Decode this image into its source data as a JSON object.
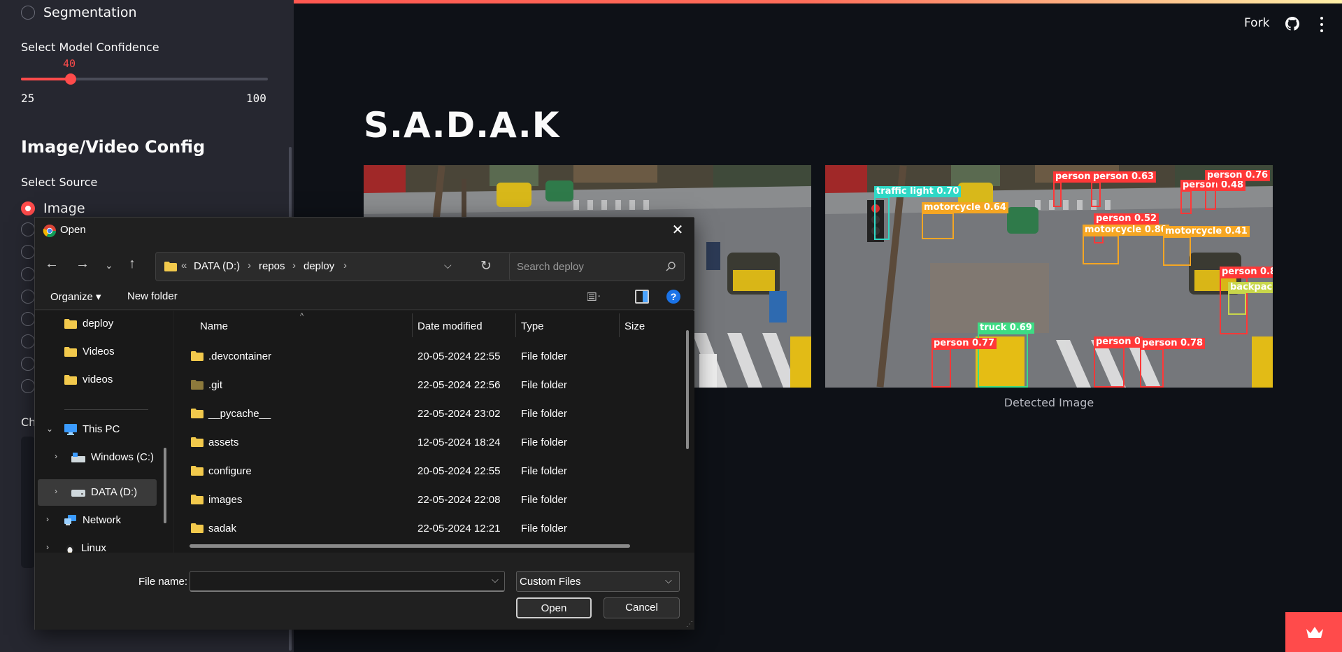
{
  "sidebar": {
    "model_task_option": "Segmentation",
    "confidence": {
      "label": "Select Model Confidence",
      "value": "40",
      "min": "25",
      "max": "100",
      "fraction": 0.2
    },
    "section_heading": "Image/Video Config",
    "source_label": "Select Source",
    "source_selected": "Image",
    "partial_label": "Ch"
  },
  "header": {
    "fork_label": "Fork",
    "github_icon": "github-icon",
    "menu_icon": "kebab-menu-icon"
  },
  "main": {
    "title": "S.A.D.A.K",
    "detected_caption": "Detected Image",
    "detections": [
      {
        "label": "traffic light 0.70",
        "color": "#2fd8c6"
      },
      {
        "label": "motorcycle 0.64",
        "color": "#f5a623"
      },
      {
        "label": "person",
        "color": "#ff3838"
      },
      {
        "label": "person 0.63",
        "color": "#ff3838"
      },
      {
        "label": "person 0.48",
        "color": "#ff3838"
      },
      {
        "label": "person 0.76",
        "color": "#ff3838"
      },
      {
        "label": "person 0.52",
        "color": "#ff3838"
      },
      {
        "label": "motorcycle 0.80",
        "color": "#f5a623"
      },
      {
        "label": "motorcycle 0.41",
        "color": "#f5a623"
      },
      {
        "label": "person 0.8",
        "color": "#ff3838"
      },
      {
        "label": "backpack",
        "color": "#c8d64b"
      },
      {
        "label": "truck 0.69",
        "color": "#3ddc84"
      },
      {
        "label": "person 0.77",
        "color": "#ff3838"
      },
      {
        "label": "person 0",
        "color": "#ff3838"
      },
      {
        "label": "person 0.78",
        "color": "#ff3838"
      }
    ]
  },
  "dialog": {
    "app_icon": "chrome-icon",
    "title": "Open",
    "breadcrumb": [
      "«",
      "DATA (D:)",
      "repos",
      "deploy"
    ],
    "search_placeholder": "Search deploy",
    "organize_label": "Organize ▾",
    "new_folder_label": "New folder",
    "tree": {
      "pinned": [
        "deploy",
        "Videos",
        "videos"
      ],
      "this_pc": "This PC",
      "drives": [
        "Windows (C:)",
        "DATA (D:)"
      ],
      "network": "Network",
      "linux": "Linux"
    },
    "columns": [
      "Name",
      "Date modified",
      "Type",
      "Size"
    ],
    "files": [
      {
        "name": ".devcontainer",
        "date": "20-05-2024 22:55",
        "type": "File folder"
      },
      {
        "name": ".git",
        "date": "22-05-2024 22:56",
        "type": "File folder"
      },
      {
        "name": "__pycache__",
        "date": "22-05-2024 23:02",
        "type": "File folder"
      },
      {
        "name": "assets",
        "date": "12-05-2024 18:24",
        "type": "File folder"
      },
      {
        "name": "configure",
        "date": "20-05-2024 22:55",
        "type": "File folder"
      },
      {
        "name": "images",
        "date": "22-05-2024 22:08",
        "type": "File folder"
      },
      {
        "name": "sadak",
        "date": "22-05-2024 12:21",
        "type": "File folder"
      }
    ],
    "file_name_label": "File name:",
    "file_name_value": "",
    "filter_value": "Custom Files",
    "open_label": "Open",
    "cancel_label": "Cancel"
  },
  "colors": {
    "accent": "#ff4b4b",
    "app_bg": "#0e1117",
    "sidebar_bg": "#262730",
    "dialog_bg": "#202020",
    "folder": "#f2c94c"
  }
}
